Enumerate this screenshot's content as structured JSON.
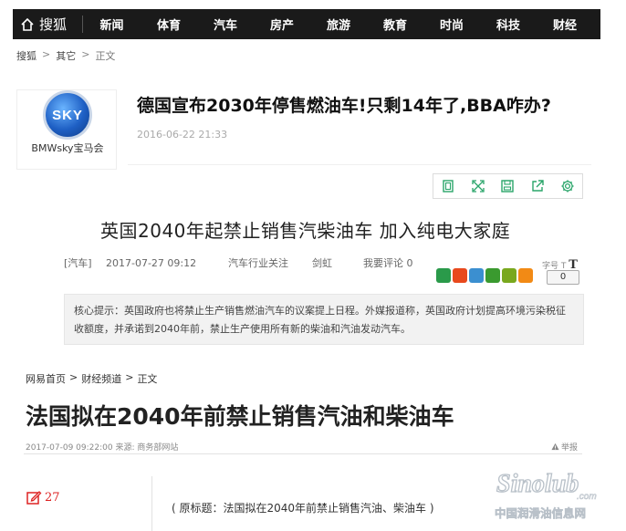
{
  "sohu": {
    "logo_text": "搜狐",
    "nav": [
      "新闻",
      "体育",
      "汽车",
      "房产",
      "旅游",
      "教育",
      "时尚",
      "科技",
      "财经"
    ],
    "breadcrumb": [
      "搜狐",
      "其它",
      "正文"
    ],
    "author": {
      "logo_text": "SKY",
      "name": "BMWsky宝马会"
    },
    "title": "德国宣布2030年停售燃油车!只剩14年了,BBA咋办?",
    "date": "2016-06-22 21:33",
    "toolbar_icons": [
      "bookmark-icon",
      "fullscreen-icon",
      "save-icon",
      "share-icon",
      "settings-icon"
    ]
  },
  "uk": {
    "title": "英国2040年起禁止销售汽柴油车 加入纯电大家庭",
    "meta": {
      "channel": "[汽车]",
      "datetime": "2017-07-27 09:12",
      "column": "汽车行业关注",
      "author": "剑虹",
      "comment_label": "我要评论 0"
    },
    "font_size_label": "字号",
    "font_glyph": "T",
    "count": "0",
    "share_colors": [
      "#2a9a4a",
      "#e8491d",
      "#3b8fd0",
      "#3a9a2f",
      "#79a81e",
      "#f28a15"
    ],
    "hint": "核心提示：英国政府也将禁止生产销售燃油汽车的议案提上日程。外媒报道称，英国政府计划提高环境污染税征收额度，并承诺到2040年前，禁止生产使用所有新的柴油和汽油发动汽车。"
  },
  "netease": {
    "breadcrumb": [
      "网易首页",
      "财经频道",
      "正文"
    ],
    "title": "法国拟在2040年前禁止销售汽油和柴油车",
    "meta": "2017-07-09 09:22:00  来源: 商务部网站",
    "report_label": "举报",
    "comment_count": "27",
    "original_title": "( 原标题：法国拟在2040年前禁止销售汽油、柴油车 )"
  },
  "watermark": {
    "brand": "Sinolub",
    "domain": ".com",
    "cn": "中国润滑油信息网"
  },
  "colors": {
    "nav_bg": "#1a1a1a",
    "accent_red": "#d22",
    "sky_blue": "#1e5fc4"
  }
}
